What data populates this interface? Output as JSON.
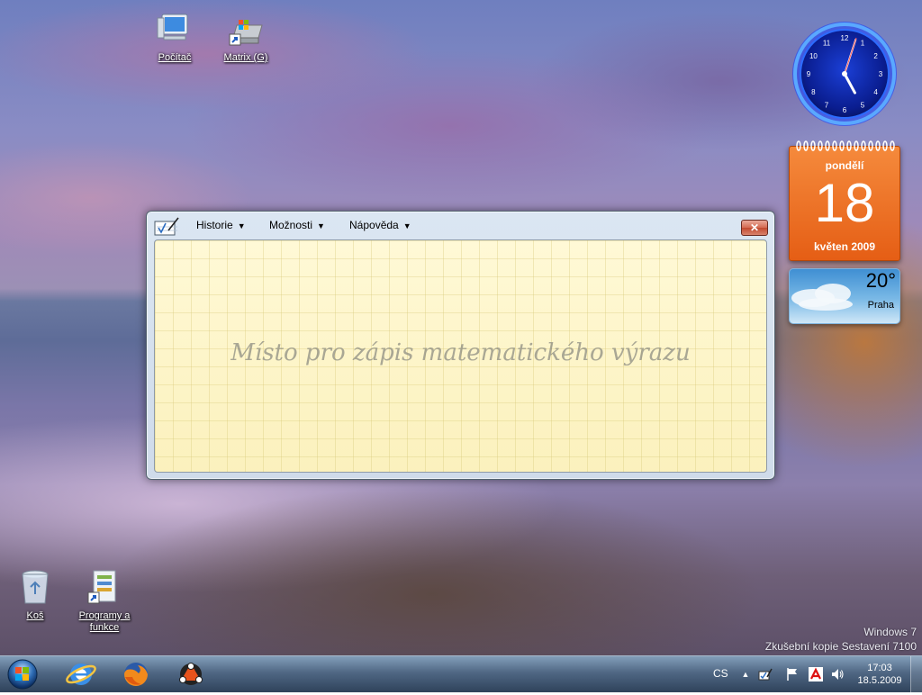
{
  "desktop": {
    "icons": [
      {
        "label": "Počítač",
        "icon": "computer-icon"
      },
      {
        "label": "Matrix (G)",
        "icon": "drive-shortcut-icon"
      },
      {
        "label": "Koš",
        "icon": "recycle-bin-icon"
      },
      {
        "label": "Programy a funkce",
        "icon": "programs-features-icon"
      }
    ]
  },
  "math_panel": {
    "menus": [
      {
        "label": "Historie"
      },
      {
        "label": "Možnosti"
      },
      {
        "label": "Nápověda"
      }
    ],
    "close_label": "✕",
    "placeholder": "Místo pro zápis matematického výrazu"
  },
  "gadgets": {
    "clock": {
      "hour": 5,
      "minute": 3,
      "second": 3
    },
    "calendar": {
      "day_name": "pondělí",
      "date": "18",
      "month_year": "květen 2009"
    },
    "weather": {
      "temperature": "20°",
      "city": "Praha"
    }
  },
  "watermark": {
    "line1": "Windows 7",
    "line2": "Zkušební kopie Sestavení 7100"
  },
  "taskbar": {
    "pinned": [
      "internet-explorer-icon",
      "firefox-icon",
      "reason-app-icon"
    ],
    "language": "CS",
    "time": "17:03",
    "date": "18.5.2009"
  },
  "colors": {
    "calendar_orange": "#e55e15",
    "clock_blue": "#1e5bff",
    "writing_pad": "#fdf6c9"
  }
}
